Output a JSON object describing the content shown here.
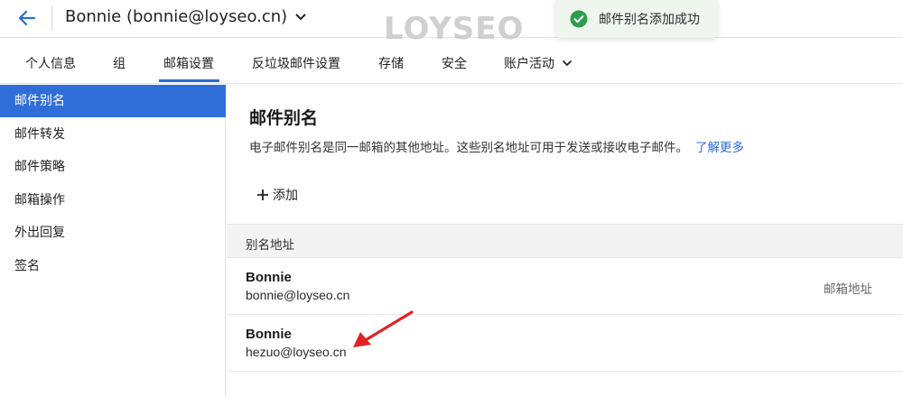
{
  "header": {
    "account_label": "Bonnie (bonnie@loyseo.cn)",
    "logo_text": "LOYSEO"
  },
  "toast": {
    "message": "邮件别名添加成功"
  },
  "tabs": [
    {
      "label": "个人信息"
    },
    {
      "label": "组"
    },
    {
      "label": "邮箱设置"
    },
    {
      "label": "反垃圾邮件设置"
    },
    {
      "label": "存储"
    },
    {
      "label": "安全"
    },
    {
      "label": "账户活动"
    }
  ],
  "sidebar": {
    "items": [
      {
        "label": "邮件别名"
      },
      {
        "label": "邮件转发"
      },
      {
        "label": "邮件策略"
      },
      {
        "label": "邮箱操作"
      },
      {
        "label": "外出回复"
      },
      {
        "label": "签名"
      }
    ]
  },
  "main": {
    "title": "邮件别名",
    "description": "电子邮件别名是同一邮箱的其他地址。这些别名地址可用于发送或接收电子邮件。",
    "learn_more": "了解更多",
    "add_label": "添加",
    "table_header": "别名地址",
    "rows": [
      {
        "name": "Bonnie",
        "email": "bonnie@loyseo.cn",
        "tag": "邮箱地址"
      },
      {
        "name": "Bonnie",
        "email": "hezuo@loyseo.cn",
        "tag": ""
      }
    ]
  },
  "colors": {
    "accent": "#2f6ed9",
    "link": "#2c6cd6",
    "success": "#2e9d4f",
    "annotation_arrow": "#e02424"
  }
}
